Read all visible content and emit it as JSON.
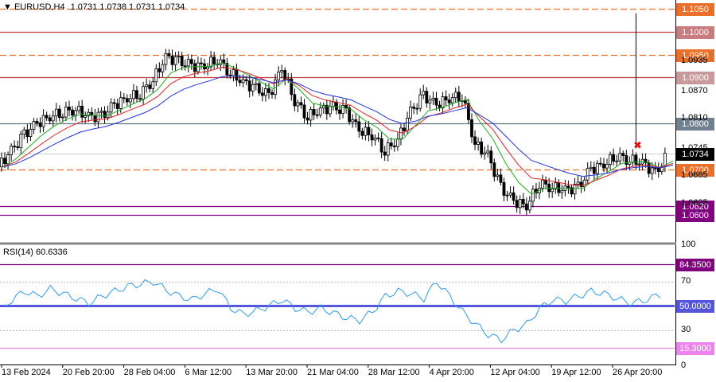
{
  "header": {
    "symbol": "EURUSD,H4",
    "ohlc": "1.0731 1.0738 1.0731 1.0734",
    "rsi_label": "RSI(14) 60.6336"
  },
  "price_levels": [
    {
      "id": "l1050",
      "value": 1.105,
      "label": "1.1050",
      "color": "#e8702a",
      "style": "dashed",
      "label_bg": "#e8702a"
    },
    {
      "id": "l1100",
      "value": 1.1,
      "label": "1.1000",
      "color": "#c0393b",
      "style": "solid",
      "label_bg": "#c97c7e"
    },
    {
      "id": "l0950",
      "value": 1.095,
      "label": "1.0950",
      "color": "#e8702a",
      "style": "dashed",
      "label_bg": "#e8702a"
    },
    {
      "id": "l0900",
      "value": 1.09,
      "label": "1.0900",
      "color": "#c0393b",
      "style": "solid",
      "label_bg": "#c99a9b"
    },
    {
      "id": "l0800",
      "value": 1.08,
      "label": "1.0800",
      "color": "#607080",
      "style": "solid",
      "label_bg": "#708090"
    },
    {
      "id": "l0700",
      "value": 1.07,
      "label": "1.0700",
      "color": "#e8702a",
      "style": "dashed",
      "label_bg": "#e8702a"
    },
    {
      "id": "l0620",
      "value": 1.062,
      "label": "1.0620",
      "color": "#800080",
      "style": "solid",
      "label_bg": "#800080"
    },
    {
      "id": "l0600",
      "value": 1.06,
      "label": "1.0600",
      "color": "#800080",
      "style": "solid",
      "label_bg": "#800080"
    }
  ],
  "current_price": {
    "value": 1.0734,
    "label": "1.0734",
    "bg": "#000000"
  },
  "price_ticks": [
    "1.0935",
    "1.0870",
    "1.0810",
    "1.0745",
    "1.0685",
    "1.0625"
  ],
  "rsi_levels": [
    {
      "id": "r84",
      "value": 84.35,
      "label": "84.3500",
      "color": "#800080",
      "label_bg": "#800080"
    },
    {
      "id": "r50",
      "value": 50,
      "label": "50.0000",
      "color": "#5555dd",
      "label_bg": "#5555dd"
    },
    {
      "id": "r15",
      "value": 15.3,
      "label": "15.3000",
      "color": "#ee82ee",
      "label_bg": "#ee82ee"
    }
  ],
  "rsi_ticks": [
    "100",
    "70",
    "30",
    "0"
  ],
  "x_labels": [
    "13 Feb 2024",
    "20 Feb 20:00",
    "28 Feb 04:00",
    "6 Mar 12:00",
    "13 Mar 20:00",
    "21 Mar 04:00",
    "28 Mar 12:00",
    "4 Apr 20:00",
    "12 Apr 04:00",
    "19 Apr 12:00",
    "26 Apr 20:00"
  ],
  "colors": {
    "candle": "#000000",
    "ma_fast": "#22aa22",
    "ma_mid": "#dd2222",
    "ma_slow": "#2233dd",
    "rsi_line": "#3399ee",
    "signal_marker": "#dd1111"
  },
  "chart_data": {
    "type": "line",
    "title": "EURUSD,H4",
    "close_points": [
      [
        "13 Feb",
        1.0705
      ],
      [
        "15 Feb",
        1.074
      ],
      [
        "16 Feb",
        1.0775
      ],
      [
        "20 Feb",
        1.08
      ],
      [
        "21 Feb",
        1.0815
      ],
      [
        "23 Feb",
        1.0825
      ],
      [
        "26 Feb",
        1.083
      ],
      [
        "28 Feb",
        1.0815
      ],
      [
        "29 Feb",
        1.0815
      ],
      [
        "1 Mar",
        1.084
      ],
      [
        "4 Mar",
        1.0855
      ],
      [
        "5 Mar",
        1.0865
      ],
      [
        "6 Mar",
        1.0895
      ],
      [
        "7 Mar",
        1.0945
      ],
      [
        "8 Mar",
        1.0935
      ],
      [
        "11 Mar",
        1.0925
      ],
      [
        "12 Mar",
        1.0925
      ],
      [
        "13 Mar",
        1.094
      ],
      [
        "14 Mar",
        1.091
      ],
      [
        "15 Mar",
        1.089
      ],
      [
        "18 Mar",
        1.0875
      ],
      [
        "19 Mar",
        1.086
      ],
      [
        "20 Mar",
        1.092
      ],
      [
        "21 Mar",
        1.085
      ],
      [
        "22 Mar",
        1.0815
      ],
      [
        "25 Mar",
        1.083
      ],
      [
        "26 Mar",
        1.0835
      ],
      [
        "27 Mar",
        1.0825
      ],
      [
        "28 Mar",
        1.0785
      ],
      [
        "29 Mar",
        1.0775
      ],
      [
        "1 Apr",
        1.074
      ],
      [
        "2 Apr",
        1.0765
      ],
      [
        "3 Apr",
        1.0825
      ],
      [
        "4 Apr",
        1.086
      ],
      [
        "5 Apr",
        1.084
      ],
      [
        "8 Apr",
        1.0855
      ],
      [
        "9 Apr",
        1.086
      ],
      [
        "10 Apr",
        1.0755
      ],
      [
        "11 Apr",
        1.073
      ],
      [
        "12 Apr",
        1.066
      ],
      [
        "15 Apr",
        1.063
      ],
      [
        "16 Apr",
        1.062
      ],
      [
        "17 Apr",
        1.067
      ],
      [
        "18 Apr",
        1.066
      ],
      [
        "19 Apr",
        1.0655
      ],
      [
        "22 Apr",
        1.066
      ],
      [
        "23 Apr",
        1.07
      ],
      [
        "24 Apr",
        1.071
      ],
      [
        "25 Apr",
        1.073
      ],
      [
        "26 Apr",
        1.072
      ],
      [
        "29 Apr",
        1.0715
      ],
      [
        "30 Apr",
        1.069
      ],
      [
        "1 May",
        1.0734
      ]
    ],
    "rsi": [
      44,
      55,
      62,
      58,
      64,
      60,
      56,
      52,
      58,
      62,
      66,
      68,
      70,
      63,
      58,
      55,
      60,
      64,
      48,
      43,
      46,
      50,
      55,
      48,
      45,
      48,
      44,
      40,
      38,
      45,
      58,
      62,
      60,
      56,
      70,
      58,
      45,
      35,
      26,
      22,
      30,
      35,
      48,
      55,
      54,
      58,
      62,
      60,
      56,
      52,
      54,
      58,
      61
    ],
    "signal_x": "26 Apr",
    "signal_price": 1.0752,
    "spike_high": 1.104
  }
}
